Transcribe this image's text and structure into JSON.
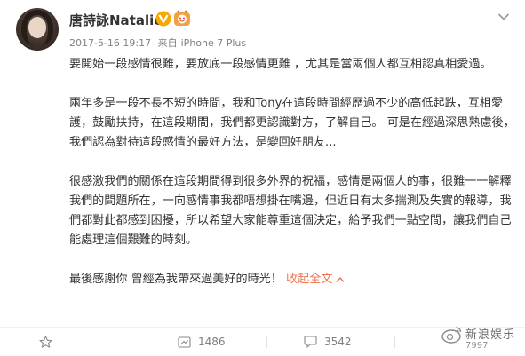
{
  "post": {
    "author": "唐詩詠Natalie",
    "date": "2017-5-16 19:17",
    "source_prefix": "来自",
    "source": "iPhone 7 Plus",
    "paragraphs": [
      "要開始一段感情很難，要放底一段感情更難 ，尤其是當兩個人都互相認真相愛過。",
      "兩年多是一段不長不短的時間，我和Tony在這段時間經歷過不少的高低起跌，互相愛護，鼓勵扶持，在這段期間，我們都更認識對方，了解自己。 可是在經過深思熟慮後，我們認為對待這段感情的最好方法，是變回好朋友...",
      "很感激我們的關係在這段期間得到很多外界的祝福，感情是兩個人的事，很難一一解釋我們的問題所在，一向感情事我都唔想掛在嘴邊，但近日有太多揣測及失實的報導，我們都對此都感到困擾，所以希望大家能尊重這個決定，給予我們一點空間，讓我們自己能處理這個艱難的時刻。"
    ],
    "closing": "最後感謝你 曾經為我帶來過美好的時光！",
    "collapse_label": "收起全文"
  },
  "actions": {
    "repost_count": "1486",
    "comment_count": "3542"
  },
  "watermark": {
    "text": "新浪娱乐",
    "sub": "7997"
  },
  "colors": {
    "link": "#eb7350",
    "verified": "#f6a800",
    "meta": "#808080"
  }
}
